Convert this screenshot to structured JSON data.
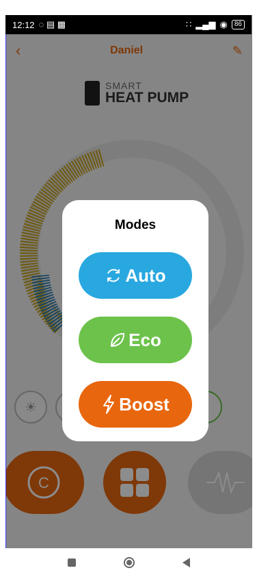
{
  "status": {
    "time": "12:12",
    "battery": "86"
  },
  "appbar": {
    "title": "Daniel"
  },
  "logo": {
    "line1": "SMART",
    "line2": "HEAT PUMP"
  },
  "bottom_buttons": {
    "compressor_letter": "C"
  },
  "modal": {
    "title": "Modes",
    "options": [
      {
        "label": "Auto",
        "color": "#29a8e0",
        "icon": "sync-icon"
      },
      {
        "label": "Eco",
        "color": "#6cc24a",
        "icon": "leaf-icon"
      },
      {
        "label": "Boost",
        "color": "#e8660e",
        "icon": "bolt-icon"
      }
    ]
  },
  "colors": {
    "accent": "#e8660e",
    "auto": "#29a8e0",
    "eco": "#6cc24a",
    "boost": "#e8660e"
  }
}
